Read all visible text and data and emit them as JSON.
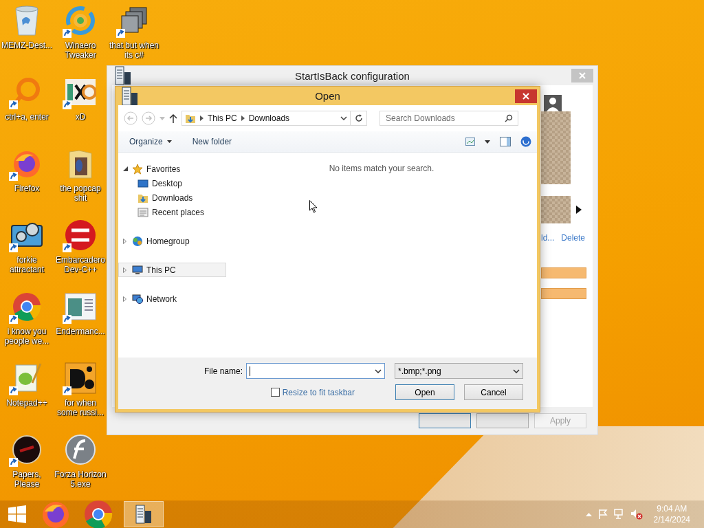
{
  "desktop": {
    "columns": [
      [
        {
          "label": "MEMZ-Dest...",
          "kind": "bin",
          "shortcut": false
        },
        {
          "label": "ctrl+a, enter",
          "kind": "ring",
          "shortcut": true
        },
        {
          "label": "Firefox",
          "kind": "fox",
          "shortcut": true
        },
        {
          "label": "forkie attractant",
          "kind": "gears",
          "shortcut": true
        },
        {
          "label": "i know you people we...",
          "kind": "chrome",
          "shortcut": true
        },
        {
          "label": "Notepad++",
          "kind": "notepad",
          "shortcut": true
        },
        {
          "label": "Papers, Please",
          "kind": "dark",
          "shortcut": true
        }
      ],
      [
        {
          "label": "Winaero Tweaker",
          "kind": "swirl",
          "shortcut": true
        },
        {
          "label": "xD",
          "kind": "hex",
          "shortcut": true
        },
        {
          "label": "the popcap shit",
          "kind": "folder",
          "shortcut": false
        },
        {
          "label": "Embarcadero Dev-C++",
          "kind": "dev",
          "shortcut": true
        },
        {
          "label": "Endermanc...",
          "kind": "window",
          "shortcut": true
        },
        {
          "label": "for when some russi...",
          "kind": "letters",
          "shortcut": true
        },
        {
          "label": "Forza Horizon 5.exe",
          "kind": "flash",
          "shortcut": false
        }
      ],
      [
        {
          "label": "that but when its c#",
          "kind": "stack",
          "shortcut": true
        }
      ]
    ]
  },
  "config_window": {
    "title": "StartIsBack configuration",
    "links": [
      "ld...",
      "Delete"
    ],
    "apply_button": {
      "label": "Apply",
      "disabled": true
    }
  },
  "open_dialog": {
    "title": "Open",
    "address": [
      "This PC",
      "Downloads"
    ],
    "search": {
      "placeholder": "Search Downloads"
    },
    "commands": {
      "organize": "Organize",
      "new_folder": "New folder"
    },
    "tree": [
      {
        "label": "Favorites",
        "kind": "star",
        "expanded": true,
        "selected": false,
        "children": [
          {
            "label": "Desktop",
            "kind": "desktop",
            "selected": false
          },
          {
            "label": "Downloads",
            "kind": "downloads",
            "selected": false
          },
          {
            "label": "Recent places",
            "kind": "recent",
            "selected": false
          }
        ]
      },
      {
        "label": "Homegroup",
        "kind": "homegroup",
        "expanded": false,
        "selected": false
      },
      {
        "label": "This PC",
        "kind": "pc",
        "expanded": false,
        "selected": true
      },
      {
        "label": "Network",
        "kind": "network",
        "expanded": false,
        "selected": false
      }
    ],
    "empty_message": "No items match your search.",
    "file_name_label": "File name:",
    "file_type": "*.bmp;*.png",
    "resize_checkbox": {
      "label": "Resize to fit taskbar",
      "checked": false
    },
    "buttons": [
      {
        "label": "Open",
        "default": true
      },
      {
        "label": "Cancel",
        "default": false
      }
    ]
  },
  "taskbar": {
    "apps": [
      {
        "kind": "fox",
        "active": false
      },
      {
        "kind": "chrome",
        "active": false
      },
      {
        "kind": "config",
        "active": true
      }
    ],
    "volume_muted": true,
    "clock": {
      "time": "9:04 AM",
      "date": "2/14/2024"
    }
  }
}
